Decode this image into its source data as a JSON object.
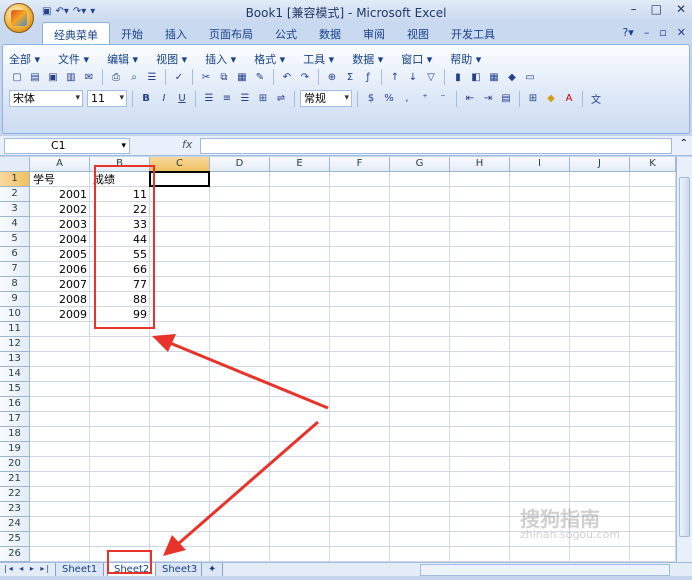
{
  "window": {
    "title": "Book1 [兼容模式] - Microsoft Excel"
  },
  "ribbon_tabs": [
    "经典菜单",
    "开始",
    "插入",
    "页面布局",
    "公式",
    "数据",
    "审阅",
    "视图",
    "开发工具"
  ],
  "classic_menu": [
    "全部 ▾",
    "文件 ▾",
    "编辑 ▾",
    "视图 ▾",
    "插入 ▾",
    "格式 ▾",
    "工具 ▾",
    "数据 ▾",
    "窗口 ▾",
    "帮助 ▾"
  ],
  "toolbar": {
    "font": "宋体",
    "size": "11",
    "number_format": "常规",
    "bold": "B",
    "italic": "I",
    "underline": "U"
  },
  "formula_bar": {
    "name_box": "C1",
    "fx": "fx",
    "value": ""
  },
  "columns": [
    "A",
    "B",
    "C",
    "D",
    "E",
    "F",
    "G",
    "H",
    "I",
    "J",
    "K"
  ],
  "rows": [
    "1",
    "2",
    "3",
    "4",
    "5",
    "6",
    "7",
    "8",
    "9",
    "10",
    "11",
    "12",
    "13",
    "14",
    "15",
    "16",
    "17",
    "18",
    "19",
    "20",
    "21",
    "22",
    "23",
    "24",
    "25",
    "26"
  ],
  "cells": {
    "header": {
      "a": "学号",
      "b": "成绩"
    },
    "data": [
      {
        "a": "2001",
        "b": "11"
      },
      {
        "a": "2002",
        "b": "22"
      },
      {
        "a": "2003",
        "b": "33"
      },
      {
        "a": "2004",
        "b": "44"
      },
      {
        "a": "2005",
        "b": "55"
      },
      {
        "a": "2006",
        "b": "66"
      },
      {
        "a": "2007",
        "b": "77"
      },
      {
        "a": "2008",
        "b": "88"
      },
      {
        "a": "2009",
        "b": "99"
      }
    ]
  },
  "sheets": [
    {
      "name": "Sheet1",
      "active": false
    },
    {
      "name": "Sheet2",
      "active": true
    },
    {
      "name": "Sheet3",
      "active": false
    }
  ],
  "watermark": {
    "line1": "搜狗指南",
    "line2": "zhinan.sogou.com"
  },
  "colors": {
    "accent": "#e8332a",
    "selection_header": "#f1c15f"
  }
}
